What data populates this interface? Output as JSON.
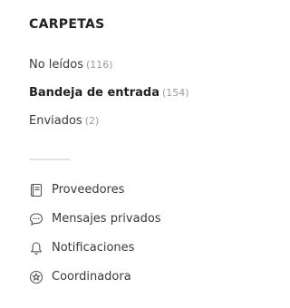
{
  "sidebar": {
    "title": "CARPETAS",
    "folders": [
      {
        "name": "No leídos",
        "count": "(116)"
      },
      {
        "name": "Bandeja de entrada",
        "count": "(154)"
      },
      {
        "name": "Enviados",
        "count": "(2)"
      }
    ],
    "links": [
      {
        "label": "Proveedores",
        "icon": "book-icon"
      },
      {
        "label": "Mensajes privados",
        "icon": "chat-bubble-icon"
      },
      {
        "label": "Notificaciones",
        "icon": "bell-icon"
      },
      {
        "label": "Coordinadora",
        "icon": "star-badge-icon"
      }
    ]
  }
}
